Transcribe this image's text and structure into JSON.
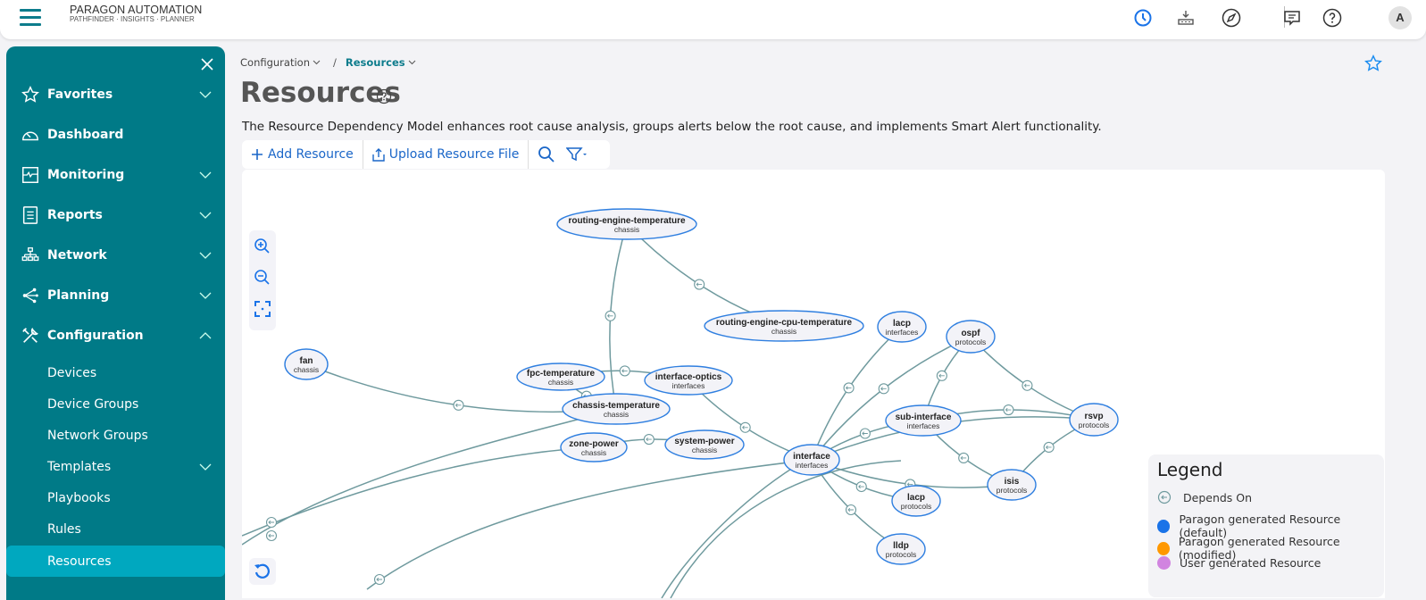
{
  "app": {
    "brand_title": "PARAGON AUTOMATION",
    "brand_subtitle": "PATHFINDER · INSIGHTS · PLANNER",
    "avatar_initial": "A",
    "top_icons": [
      "clock-icon",
      "download-icon",
      "rocket-icon",
      "feedback-icon",
      "help-icon"
    ]
  },
  "sidebar": {
    "items": [
      {
        "label": "Favorites",
        "icon": "star-icon",
        "expandable": true
      },
      {
        "label": "Dashboard",
        "icon": "dashboard-gauge-icon",
        "expandable": false
      },
      {
        "label": "Monitoring",
        "icon": "monitoring-pulse-icon",
        "expandable": true
      },
      {
        "label": "Reports",
        "icon": "report-document-icon",
        "expandable": true
      },
      {
        "label": "Network",
        "icon": "network-tree-icon",
        "expandable": true
      },
      {
        "label": "Planning",
        "icon": "planning-share-icon",
        "expandable": true
      },
      {
        "label": "Configuration",
        "icon": "tools-icon",
        "expandable": true,
        "expanded": true
      }
    ],
    "sub_items": [
      {
        "label": "Devices"
      },
      {
        "label": "Device Groups"
      },
      {
        "label": "Network Groups"
      },
      {
        "label": "Templates",
        "expandable": true
      },
      {
        "label": "Playbooks"
      },
      {
        "label": "Rules"
      },
      {
        "label": "Resources",
        "active": true
      }
    ]
  },
  "breadcrumb": {
    "items": [
      "Configuration",
      "Resources"
    ],
    "separator": "/"
  },
  "page": {
    "title": "Resources",
    "description": "The Resource Dependency Model enhances root cause analysis, groups alerts below the root cause, and implements Smart Alert functionality."
  },
  "toolbar": {
    "add_label": "Add Resource",
    "upload_label": "Upload Resource File"
  },
  "graph": {
    "nodes": [
      {
        "id": "ret",
        "name": "routing-engine-temperature",
        "category": "chassis"
      },
      {
        "id": "rect",
        "name": "routing-engine-cpu-temperature",
        "category": "chassis"
      },
      {
        "id": "fan",
        "name": "fan",
        "category": "chassis"
      },
      {
        "id": "fpc",
        "name": "fpc-temperature",
        "category": "chassis"
      },
      {
        "id": "iopt",
        "name": "interface-optics",
        "category": "interfaces"
      },
      {
        "id": "ct",
        "name": "chassis-temperature",
        "category": "chassis"
      },
      {
        "id": "zp",
        "name": "zone-power",
        "category": "chassis"
      },
      {
        "id": "sp",
        "name": "system-power",
        "category": "chassis"
      },
      {
        "id": "intf",
        "name": "interface",
        "category": "interfaces"
      },
      {
        "id": "lacpi",
        "name": "lacp",
        "category": "interfaces"
      },
      {
        "id": "ospf",
        "name": "ospf",
        "category": "protocols"
      },
      {
        "id": "subi",
        "name": "sub-interface",
        "category": "interfaces"
      },
      {
        "id": "rsvp",
        "name": "rsvp",
        "category": "protocols"
      },
      {
        "id": "isis",
        "name": "isis",
        "category": "protocols"
      },
      {
        "id": "lacpp",
        "name": "lacp",
        "category": "protocols"
      },
      {
        "id": "lldp",
        "name": "lldp",
        "category": "protocols"
      }
    ],
    "edges": [
      [
        "ret",
        "ct"
      ],
      [
        "ret",
        "rect"
      ],
      [
        "fan",
        "ct"
      ],
      [
        "fpc",
        "ct"
      ],
      [
        "iopt",
        "fpc"
      ],
      [
        "iopt",
        "intf"
      ],
      [
        "sp",
        "zp"
      ],
      [
        "lacpi",
        "intf"
      ],
      [
        "ospf",
        "intf"
      ],
      [
        "ospf",
        "subi"
      ],
      [
        "ospf",
        "rsvp"
      ],
      [
        "subi",
        "intf"
      ],
      [
        "rsvp",
        "subi"
      ],
      [
        "rsvp",
        "intf"
      ],
      [
        "subi",
        "isis"
      ],
      [
        "rsvp",
        "isis"
      ],
      [
        "intf",
        "isis"
      ],
      [
        "intf",
        "lacpp"
      ],
      [
        "intf",
        "lldp"
      ]
    ]
  },
  "legend": {
    "title": "Legend",
    "items": [
      {
        "label": "Depends On",
        "type": "arrow"
      },
      {
        "label": "Paragon generated Resource (default)",
        "color": "#1a73e8"
      },
      {
        "label": "Paragon generated Resource (modified)",
        "color": "#ff9800"
      },
      {
        "label": "User generated Resource",
        "color": "#d184e0"
      }
    ]
  },
  "colors": {
    "accent": "#007a87",
    "active_nav": "#00a8bf",
    "link": "#1a66c8",
    "edge": "#6f9a9e",
    "node_border": "#2f7fe0"
  }
}
